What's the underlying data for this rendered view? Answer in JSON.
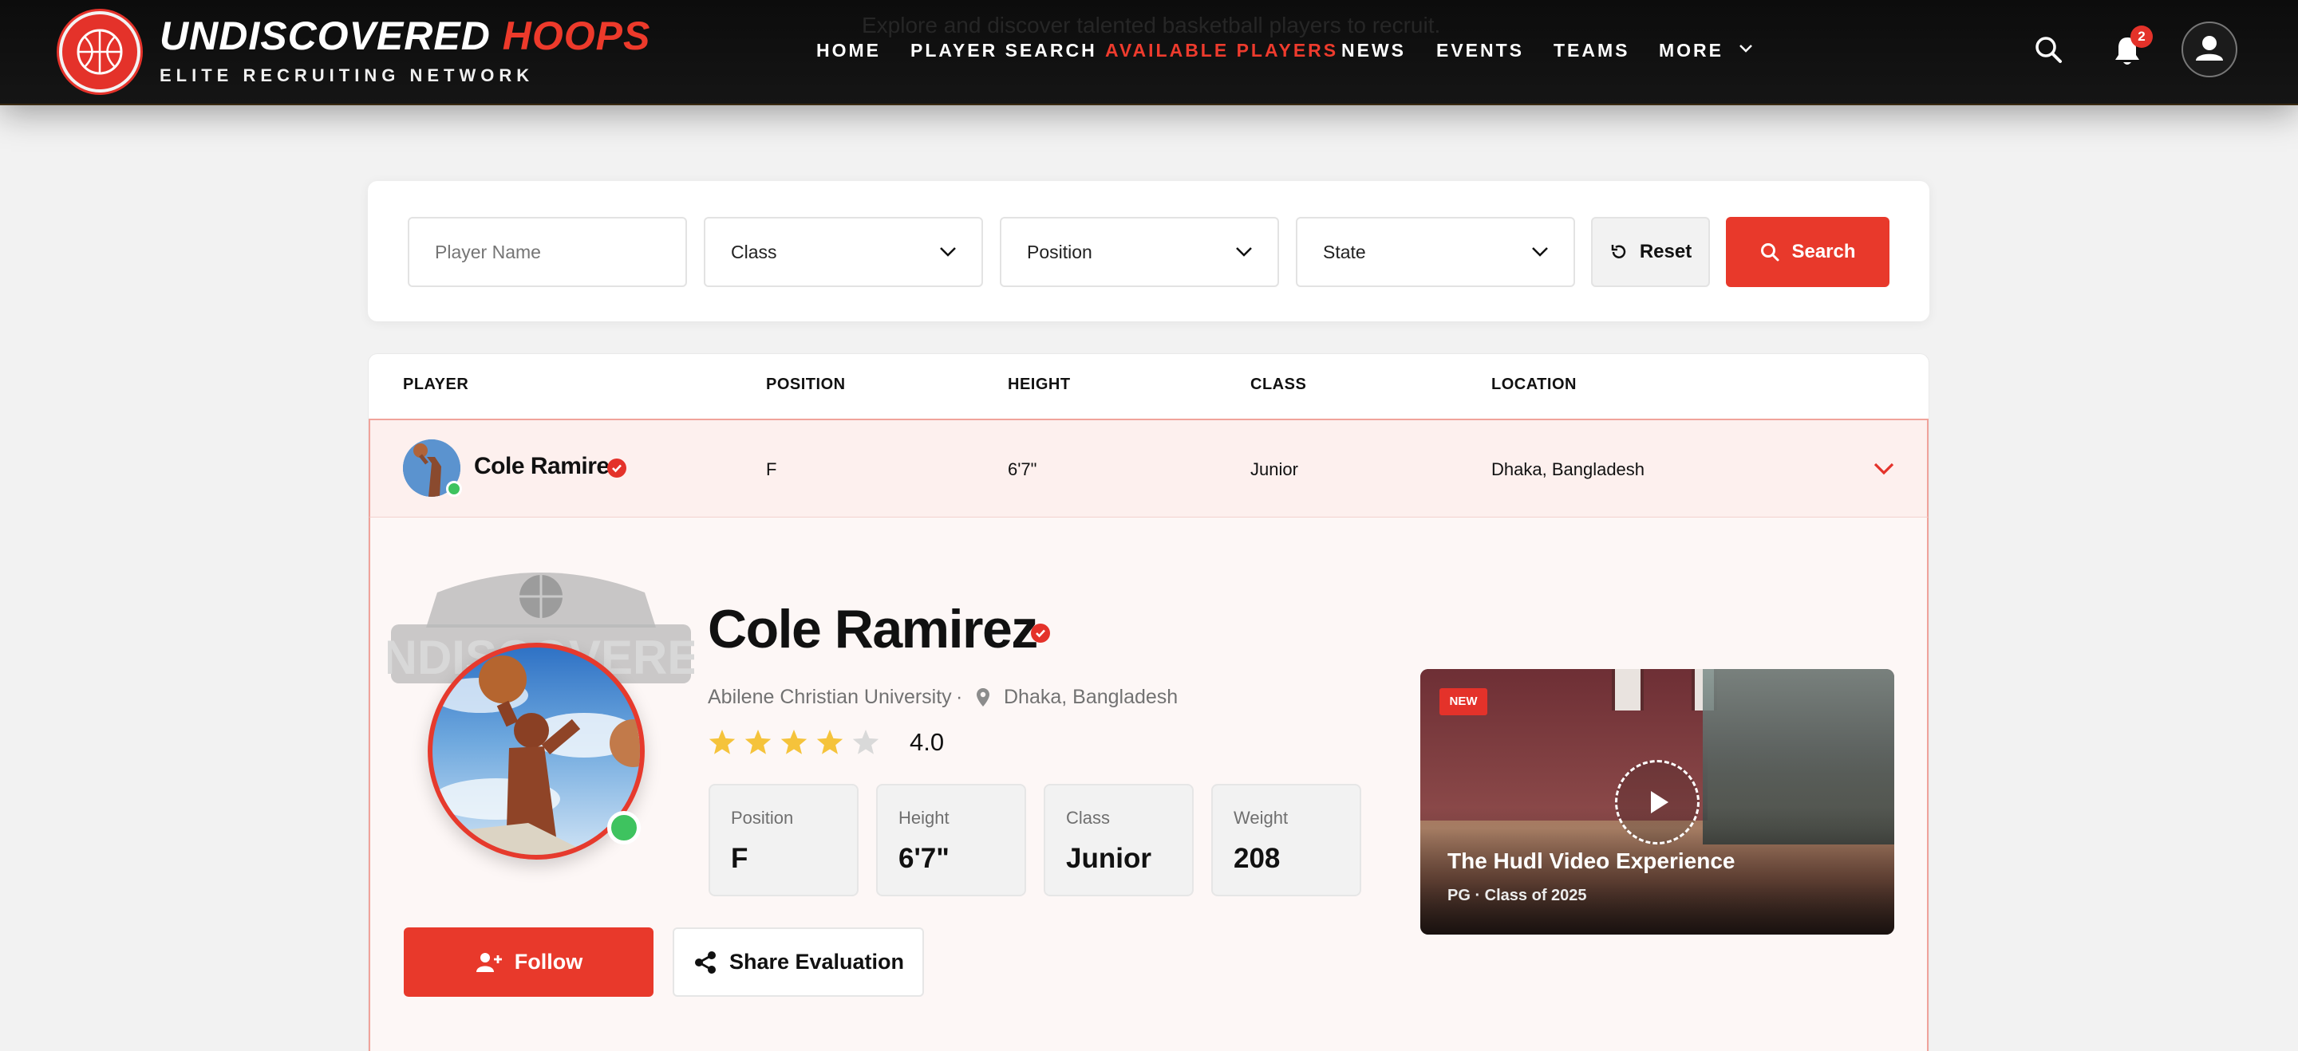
{
  "header": {
    "ghost_text": "Explore and discover talented basketball players to recruit.",
    "brand_white": "UNDISCOVERED",
    "brand_red": "HOOPS",
    "tagline": "ELITE RECRUITING NETWORK",
    "logo_text": "UNDISCOVERED HOOPS",
    "nav": [
      "HOME",
      "PLAYER SEARCH",
      "AVAILABLE PLAYERS",
      "NEWS",
      "EVENTS",
      "TEAMS",
      "MORE"
    ],
    "active_nav": "AVAILABLE PLAYERS",
    "notification_count": "2"
  },
  "filters": {
    "player_name_placeholder": "Player Name",
    "class_label": "Class",
    "position_label": "Position",
    "state_label": "State",
    "reset_label": "Reset",
    "search_label": "Search"
  },
  "table": {
    "columns": [
      "PLAYER",
      "POSITION",
      "HEIGHT",
      "CLASS",
      "LOCATION"
    ],
    "rows": [
      {
        "player": "Cole Ramirez",
        "position": "F",
        "height": "6'7\"",
        "class": "Junior",
        "location": "Dhaka, Bangladesh"
      }
    ]
  },
  "detail": {
    "watermark_text": "UNDISCOVERED",
    "name": "Cole Ramirez",
    "school": "Abilene Christian University",
    "location": "Dhaka, Bangladesh",
    "rating": "4.0",
    "rating_value": 4,
    "rating_max": 5,
    "stats": [
      {
        "label": "Position",
        "value": "F"
      },
      {
        "label": "Height",
        "value": "6'7\""
      },
      {
        "label": "Class",
        "value": "Junior"
      },
      {
        "label": "Weight",
        "value": "208"
      }
    ],
    "follow_label": "Follow",
    "share_label": "Share Evaluation"
  },
  "video": {
    "badge": "NEW",
    "title": "The Hudl Video Experience",
    "subtitle": "PG · Class of 2025"
  },
  "colors": {
    "accent": "#e8392b",
    "online": "#3ec35f",
    "star": "#f5c33b",
    "star_empty": "#d9d9d9"
  }
}
